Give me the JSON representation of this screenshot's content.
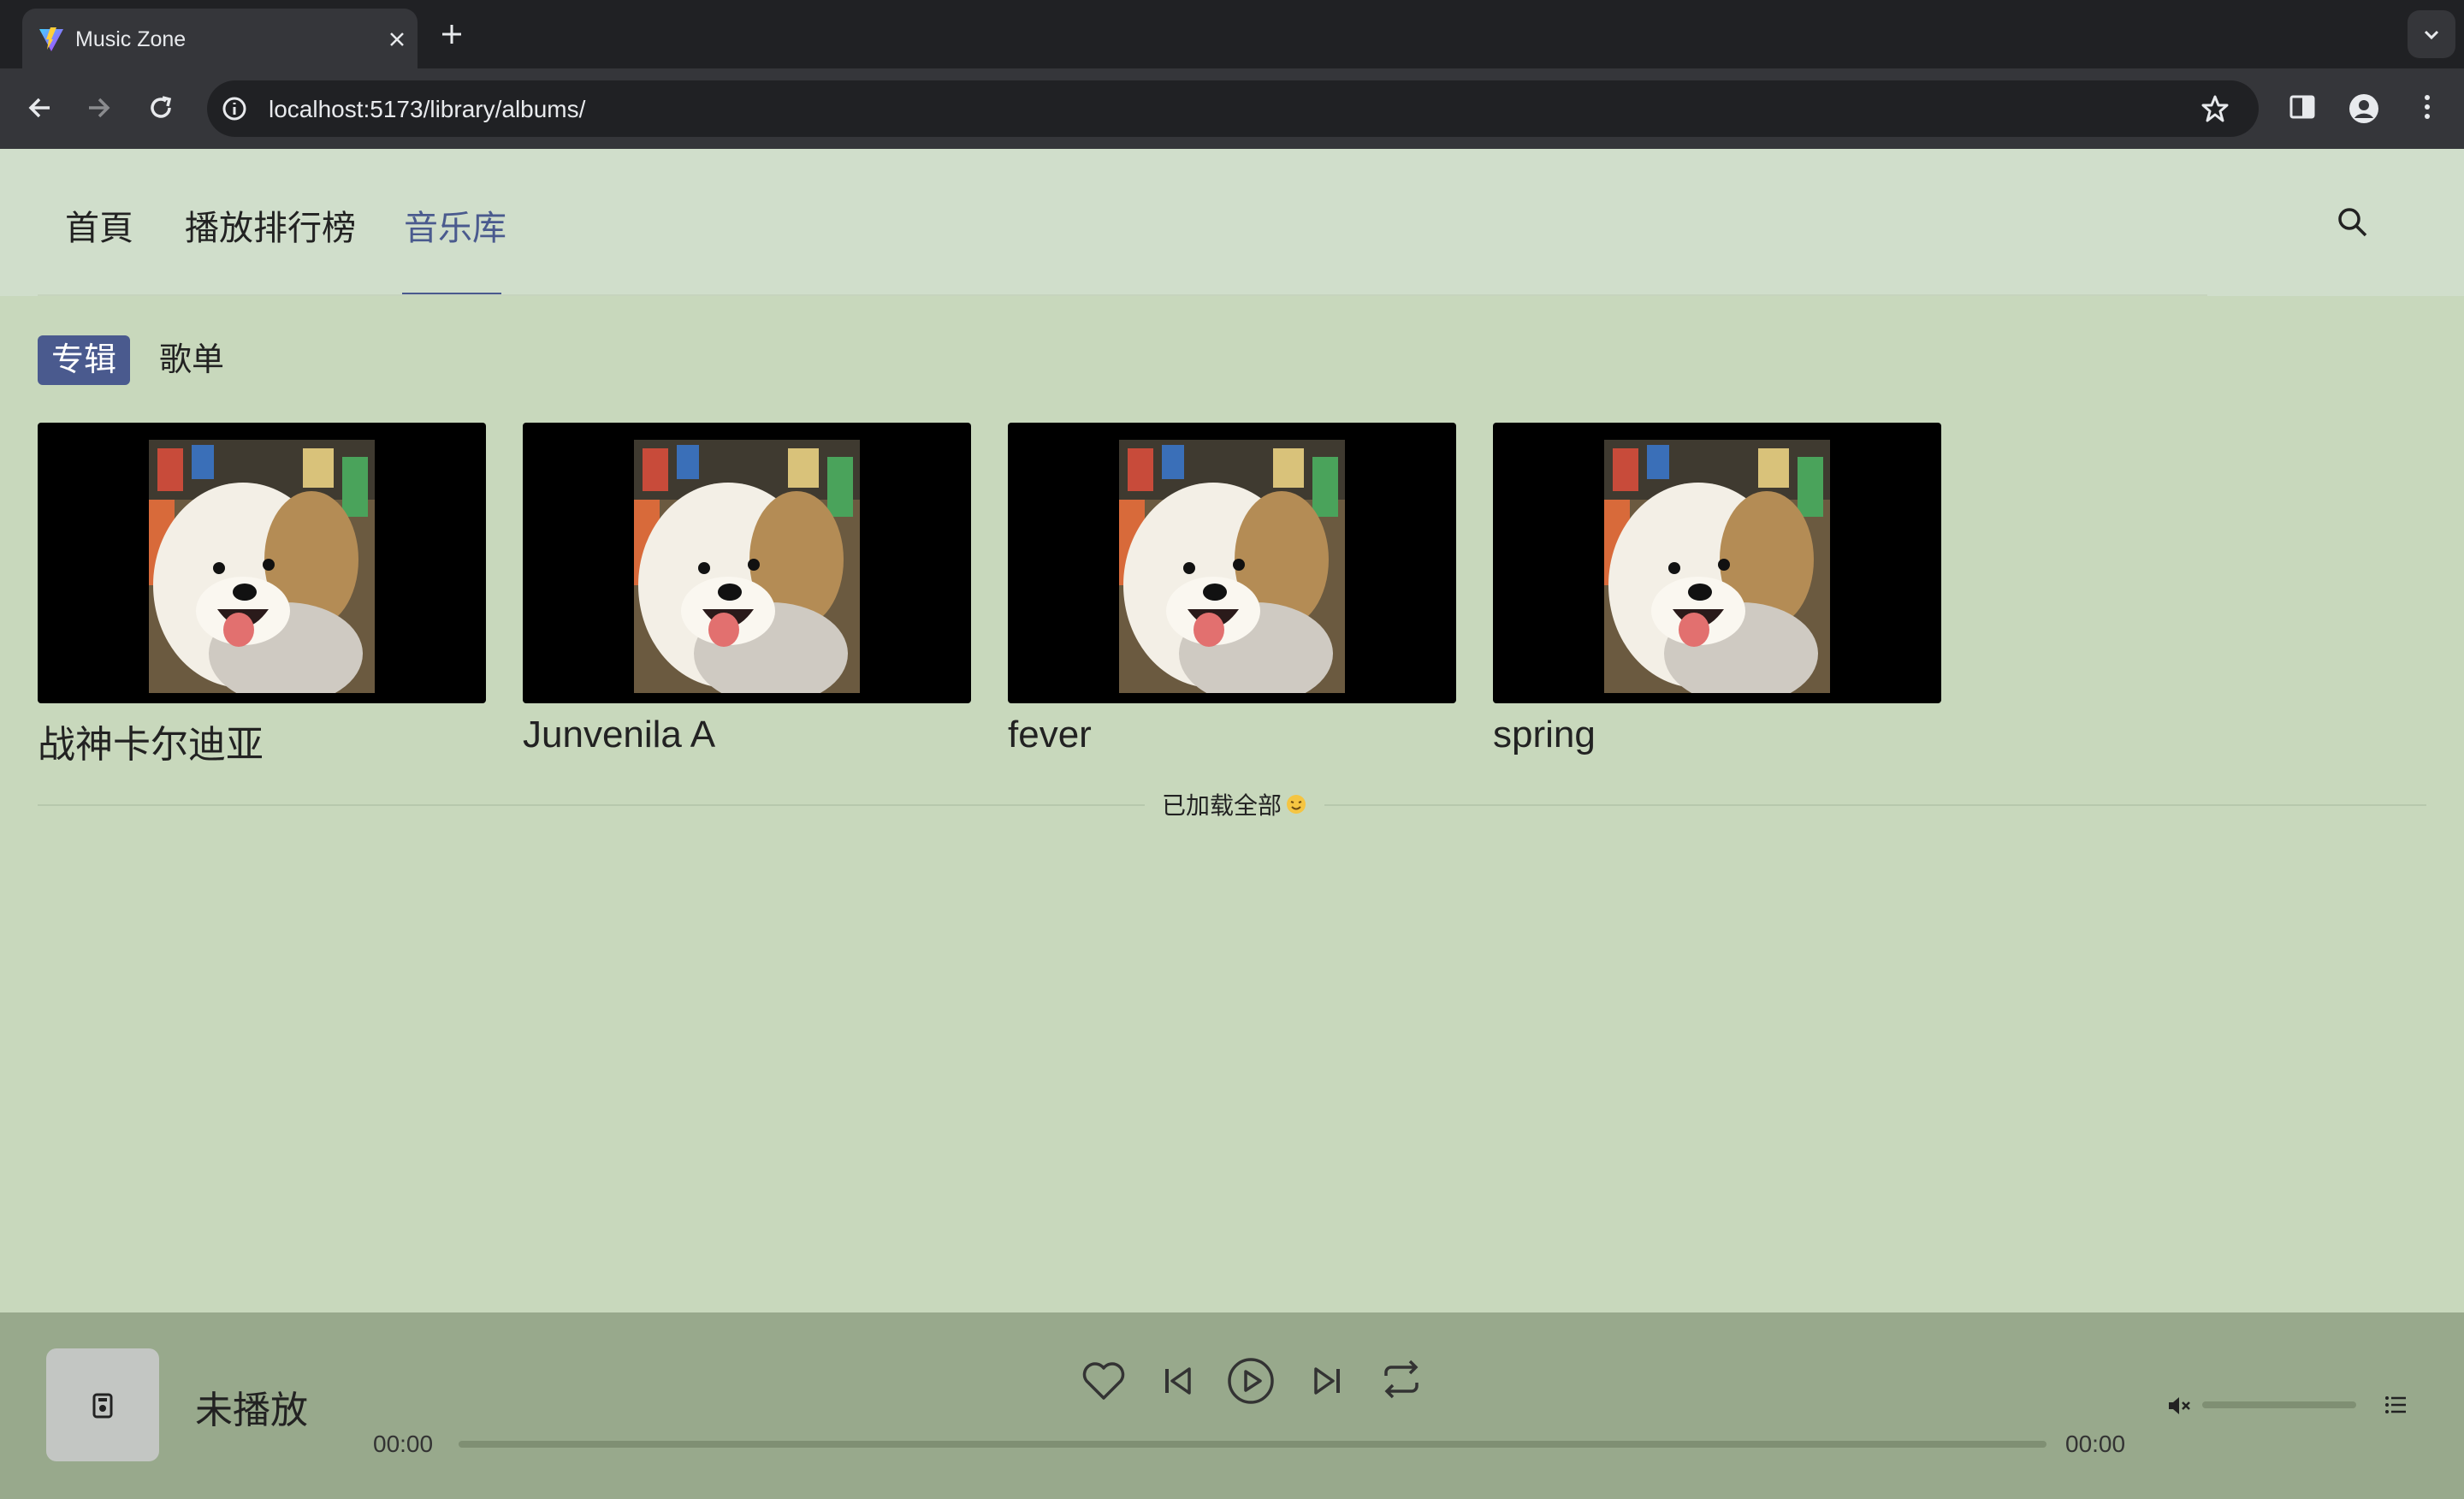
{
  "browser": {
    "tab_title": "Music Zone",
    "url": "localhost:5173/library/albums/"
  },
  "nav": {
    "items": [
      "首頁",
      "播放排行榜",
      "音乐库"
    ],
    "active_index": 2
  },
  "subtabs": {
    "items": [
      "专辑",
      "歌单"
    ],
    "active_index": 0
  },
  "albums": [
    {
      "name": "战神卡尔迪亚"
    },
    {
      "name": "Junvenila A"
    },
    {
      "name": "fever"
    },
    {
      "name": "spring"
    }
  ],
  "loaded_text": "已加载全部",
  "player": {
    "status": "未播放",
    "time_current": "00:00",
    "time_total": "00:00",
    "progress": 0,
    "volume": 0,
    "muted": true
  },
  "colors": {
    "accent": "#4a5a8e",
    "page_bg": "#c8d8bc",
    "header_bg": "#d0decb",
    "player_bg": "#98a98c"
  },
  "icons": {
    "search": "search-icon",
    "like": "heart-icon",
    "prev": "skip-previous-icon",
    "play": "play-circle-icon",
    "next": "skip-next-icon",
    "repeat": "repeat-icon",
    "volume": "volume-muted-icon",
    "playlist": "playlist-icon"
  }
}
